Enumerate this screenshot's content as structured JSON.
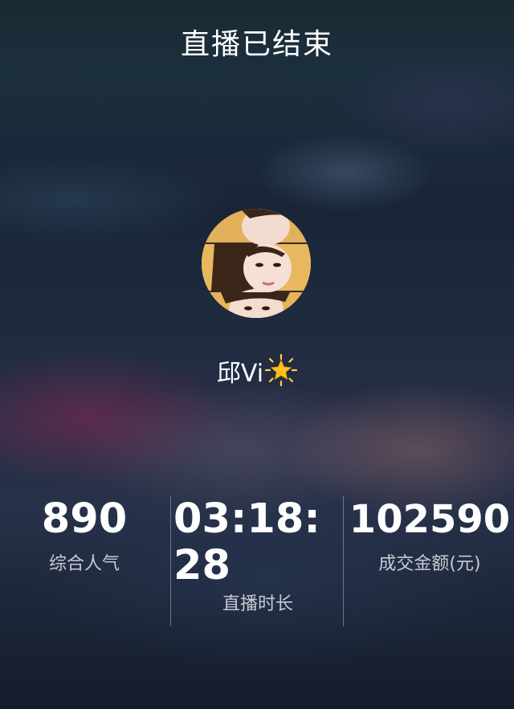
{
  "header": {
    "title": "直播已结束"
  },
  "profile": {
    "avatar_icon": "avatar",
    "name": "邱Vi",
    "emoji_icon": "glowing-star-icon"
  },
  "stats": [
    {
      "value": "890",
      "label": "综合人气"
    },
    {
      "value": "03:18:28",
      "label": "直播时长"
    },
    {
      "value": "102590",
      "label": "成交金额(元)"
    }
  ],
  "colors": {
    "text": "#ffffff",
    "avatar_accent": "#e9b85a",
    "star": "#ffc21a"
  }
}
